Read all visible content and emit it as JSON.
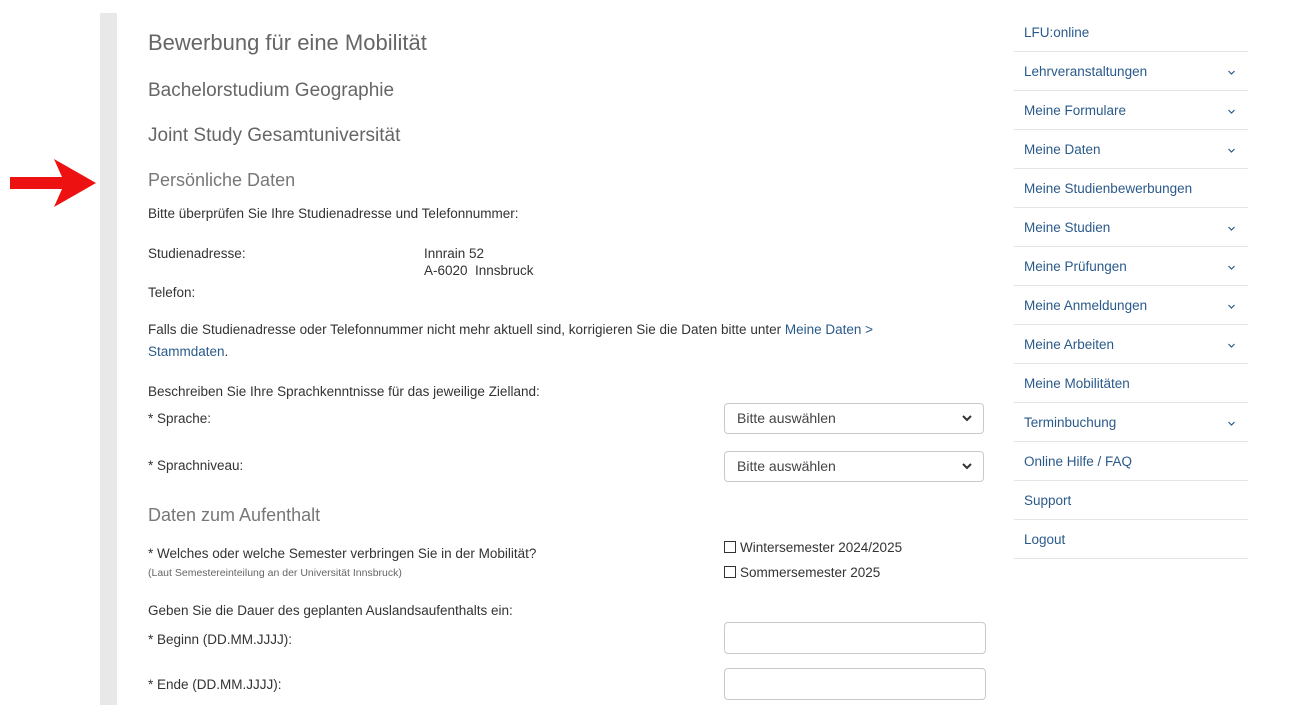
{
  "colors": {
    "link": "#2a5a8a",
    "arrow": "#ee1111",
    "heading": "#666666"
  },
  "page": {
    "title": "Bewerbung für eine Mobilität",
    "program": "Bachelorstudium Geographie",
    "mobility_type": "Joint Study Gesamtuniversität"
  },
  "personal": {
    "heading": "Persönliche Daten",
    "intro": "Bitte überprüfen Sie Ihre Studienadresse und Telefonnummer:",
    "address_label": "Studienadresse:",
    "address_line1": "Innrain 52",
    "address_line2": "A-6020  Innsbruck",
    "phone_label": "Telefon:",
    "phone_value": "",
    "note_text": "Falls die Studienadresse oder Telefonnummer nicht mehr aktuell sind, korrigieren Sie die Daten bitte unter ",
    "note_link_part1": "Meine Daten >",
    "note_link_part2": "Stammdaten",
    "note_end": "."
  },
  "language": {
    "intro": "Beschreiben Sie Ihre Sprachkenntnisse für das jeweilige Zielland:",
    "language_label": "* Sprache:",
    "language_selected": "Bitte auswählen",
    "level_label": "* Sprachniveau:",
    "level_selected": "Bitte auswählen"
  },
  "stay": {
    "heading": "Daten zum Aufenthalt",
    "semester_question": "* Welches oder welche Semester verbringen Sie in der Mobilität?",
    "semester_hint": "(Laut Semestereinteilung an der Universität Innsbruck)",
    "semester_options": [
      {
        "label": "Wintersemester 2024/2025",
        "checked": false
      },
      {
        "label": "Sommersemester 2025",
        "checked": false
      }
    ],
    "duration_intro": "Geben Sie die Dauer des geplanten Auslandsaufenthalts ein:",
    "start_label": "* Beginn (DD.MM.JJJJ):",
    "start_value": "",
    "end_label": "* Ende (DD.MM.JJJJ):",
    "end_value": ""
  },
  "sidebar": {
    "items": [
      {
        "label": "LFU:online",
        "icon": ""
      },
      {
        "label": "Lehrveranstaltungen",
        "icon": "chevron-down-icon"
      },
      {
        "label": "Meine Formulare",
        "icon": "chevron-down-icon"
      },
      {
        "label": "Meine Daten",
        "icon": "chevron-down-icon"
      },
      {
        "label": "Meine Studienbewerbungen",
        "icon": ""
      },
      {
        "label": "Meine Studien",
        "icon": "chevron-down-icon"
      },
      {
        "label": "Meine Prüfungen",
        "icon": "chevron-down-icon"
      },
      {
        "label": "Meine Anmeldungen",
        "icon": "chevron-down-icon"
      },
      {
        "label": "Meine Arbeiten",
        "icon": "chevron-down-icon"
      },
      {
        "label": "Meine Mobilitäten",
        "icon": ""
      },
      {
        "label": "Terminbuchung",
        "icon": "chevron-down-icon"
      },
      {
        "label": "Online Hilfe / FAQ",
        "icon": ""
      },
      {
        "label": "Support",
        "icon": ""
      },
      {
        "label": "Logout",
        "icon": ""
      }
    ]
  }
}
